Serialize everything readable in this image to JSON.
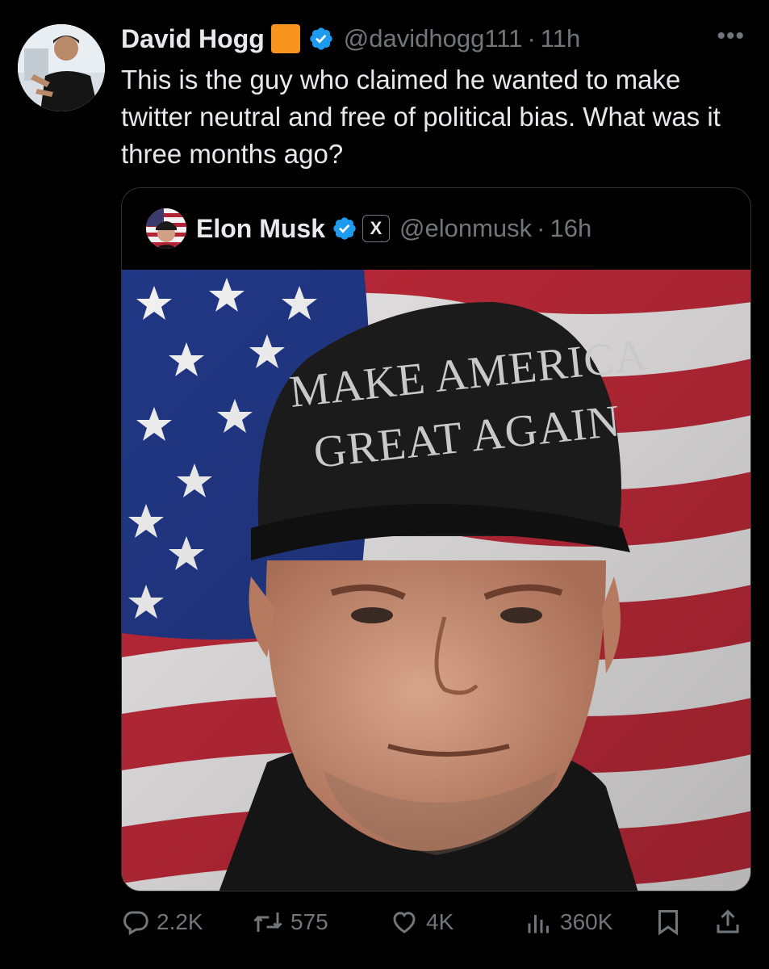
{
  "author": {
    "name": "David Hogg",
    "handle": "@davidhogg111",
    "separator": "·",
    "time": "11h",
    "more_label": "•••"
  },
  "tweet_text": "This is the guy who claimed he wanted to make twitter neutral and free of political bias. What was it three months ago?",
  "quoted": {
    "name": "Elon Musk",
    "affiliate_badge": "X",
    "handle": "@elonmusk",
    "separator": "·",
    "time": "16h",
    "hat_text_line1": "MAKE AMERICA",
    "hat_text_line2": "GREAT AGAIN"
  },
  "actions": {
    "replies": "2.2K",
    "reposts": "575",
    "likes": "4K",
    "views": "360K"
  },
  "colors": {
    "background": "#000000",
    "primary_text": "#e7e9ea",
    "secondary_text": "#71767b",
    "verified_blue": "#1d9bf0",
    "orange_square": "#f7941d",
    "border": "#2f3336"
  }
}
